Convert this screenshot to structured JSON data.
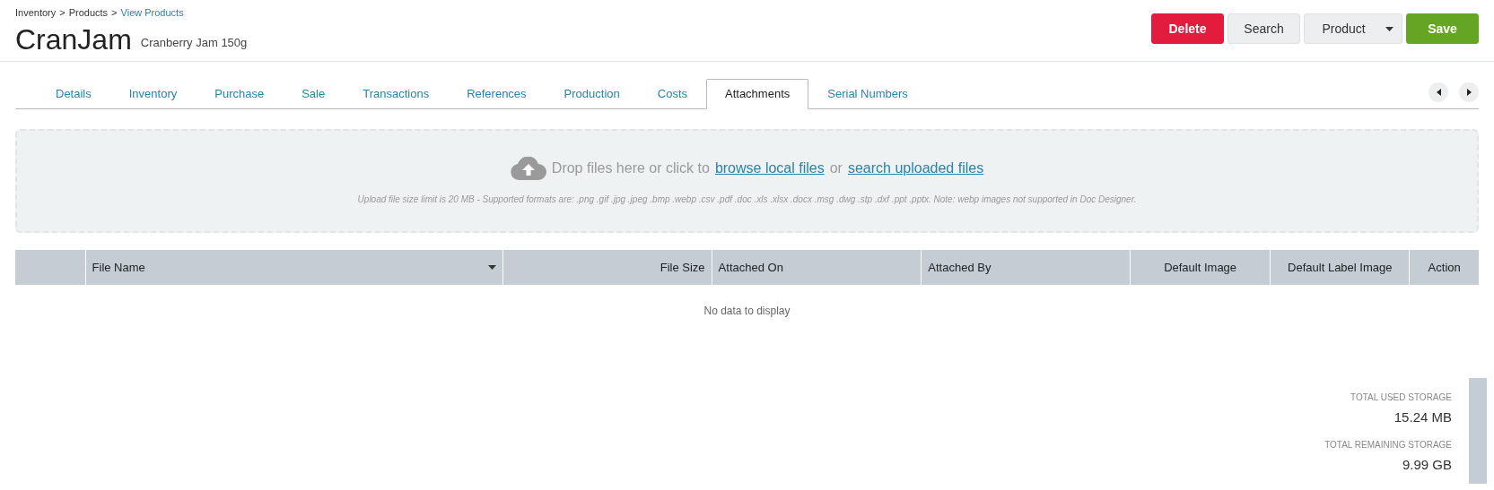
{
  "breadcrumb": [
    {
      "label": "Inventory",
      "link": false
    },
    {
      "label": "Products",
      "link": false
    },
    {
      "label": "View Products",
      "link": true
    }
  ],
  "breadcrumb_separator": ">",
  "title": "CranJam",
  "subtitle": "Cranberry Jam 150g",
  "actions": [
    {
      "label": "Delete",
      "kind": "danger"
    },
    {
      "label": "Search",
      "kind": "plain"
    },
    {
      "label": "Product",
      "kind": "dropdown"
    },
    {
      "label": "Save",
      "kind": "primary"
    }
  ],
  "tabs": [
    {
      "label": "Details",
      "selected": false
    },
    {
      "label": "Inventory",
      "selected": false
    },
    {
      "label": "Purchase",
      "selected": false
    },
    {
      "label": "Sale",
      "selected": false
    },
    {
      "label": "Transactions",
      "selected": false
    },
    {
      "label": "References",
      "selected": false
    },
    {
      "label": "Production",
      "selected": false
    },
    {
      "label": "Costs",
      "selected": false
    },
    {
      "label": "Attachments",
      "selected": true
    },
    {
      "label": "Serial Numbers",
      "selected": false
    }
  ],
  "dropzone": {
    "text_before": "Drop files here or click to",
    "link_1": "browse local files",
    "text_middle": "or",
    "link_2": "search uploaded files",
    "note": "Upload file size limit is 20 MB - Supported formats are: .png .gif .jpg .jpeg .bmp .webp .csv .pdf .doc .xls .xlsx .docx .msg .dwg .stp .dxf .ppt .pptx. Note: webp images not supported in Doc Designer."
  },
  "table": {
    "columns": [
      {
        "label": "File Name",
        "sorted": true
      },
      {
        "label": "File Size",
        "sorted": false
      },
      {
        "label": "Attached On",
        "sorted": false
      },
      {
        "label": "Attached By",
        "sorted": false
      },
      {
        "label": "Default Image",
        "sorted": false
      },
      {
        "label": "Default Label Image",
        "sorted": false
      },
      {
        "label": "Action",
        "sorted": false
      }
    ],
    "empty_text": "No data to display"
  },
  "storage": [
    {
      "label": "TOTAL USED STORAGE",
      "value": "15.24 MB"
    },
    {
      "label": "TOTAL REMAINING STORAGE",
      "value": "9.99 GB"
    }
  ]
}
